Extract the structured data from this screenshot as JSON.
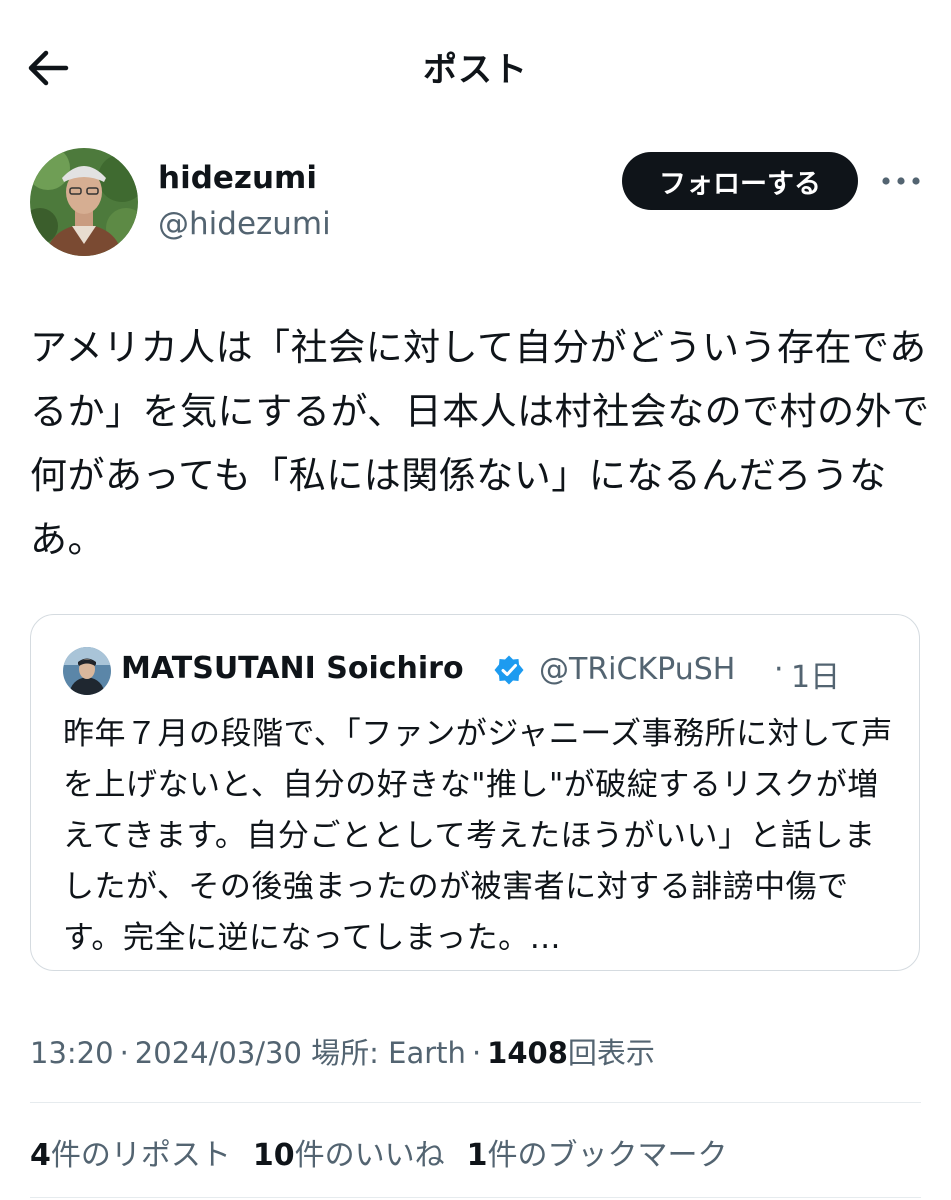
{
  "header": {
    "title": "ポスト",
    "back_icon": "arrow-left-icon"
  },
  "author": {
    "name": "hidezumi",
    "handle": "@hidezumi",
    "follow_label": "フォローする",
    "more_icon": "more-horizontal-icon"
  },
  "post": {
    "text": "アメリカ人は「社会に対して自分がどういう存在であるか」を気にするが、日本人は村社会なので村の外で何があっても「私には関係ない」になるんだろうなあ。"
  },
  "quote": {
    "name": "MATSUTANI Soichiro",
    "verified_icon": "verified-badge-icon",
    "handle": "@TRiCKPuSH",
    "separator": "·",
    "time": "1日",
    "text": "昨年７月の段階で、「ファンがジャニーズ事務所に対して声を上げないと、自分の好きな\"推し\"が破綻するリスクが増えてきます。自分ごととして考えたほうがいい」と話しましたが、その後強まったのが被害者に対する誹謗中傷です。完全に逆になってしまった。…"
  },
  "meta": {
    "time": "13:20",
    "date": "2024/03/30",
    "location": "場所: Earth",
    "views_count": "1408",
    "views_label": "回表示",
    "separator": "·"
  },
  "stats": {
    "reposts_count": "4",
    "reposts_label": "件のリポスト",
    "likes_count": "10",
    "likes_label": "件のいいね",
    "bookmarks_count": "1",
    "bookmarks_label": "件のブックマーク"
  },
  "colors": {
    "text": "#0f1419",
    "secondary": "#536471",
    "verified": "#1d9bf0",
    "border": "#d5dbe0",
    "follow_bg": "#0f1419"
  }
}
